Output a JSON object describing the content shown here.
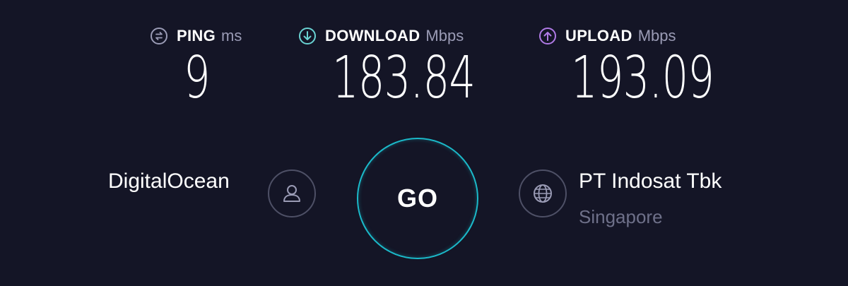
{
  "metrics": {
    "ping": {
      "label": "PING",
      "unit": "ms",
      "value": "9",
      "icon": "ping-icon",
      "color": "#9a9bb5"
    },
    "download": {
      "label": "DOWNLOAD",
      "unit": "Mbps",
      "value": "183.84",
      "icon": "arrow-down-circle-icon",
      "color": "#6ad3d3"
    },
    "upload": {
      "label": "UPLOAD",
      "unit": "Mbps",
      "value": "193.09",
      "icon": "arrow-up-circle-icon",
      "color": "#b07ae6"
    }
  },
  "host": {
    "name": "DigitalOcean",
    "icon": "user-icon"
  },
  "go_button": {
    "label": "GO",
    "ring_color": "#1bb9c9"
  },
  "isp": {
    "name": "PT Indosat Tbk",
    "location": "Singapore",
    "icon": "globe-icon"
  },
  "colors": {
    "background": "#141526",
    "muted_text": "#6e7089",
    "ring_border": "#4e5066"
  }
}
